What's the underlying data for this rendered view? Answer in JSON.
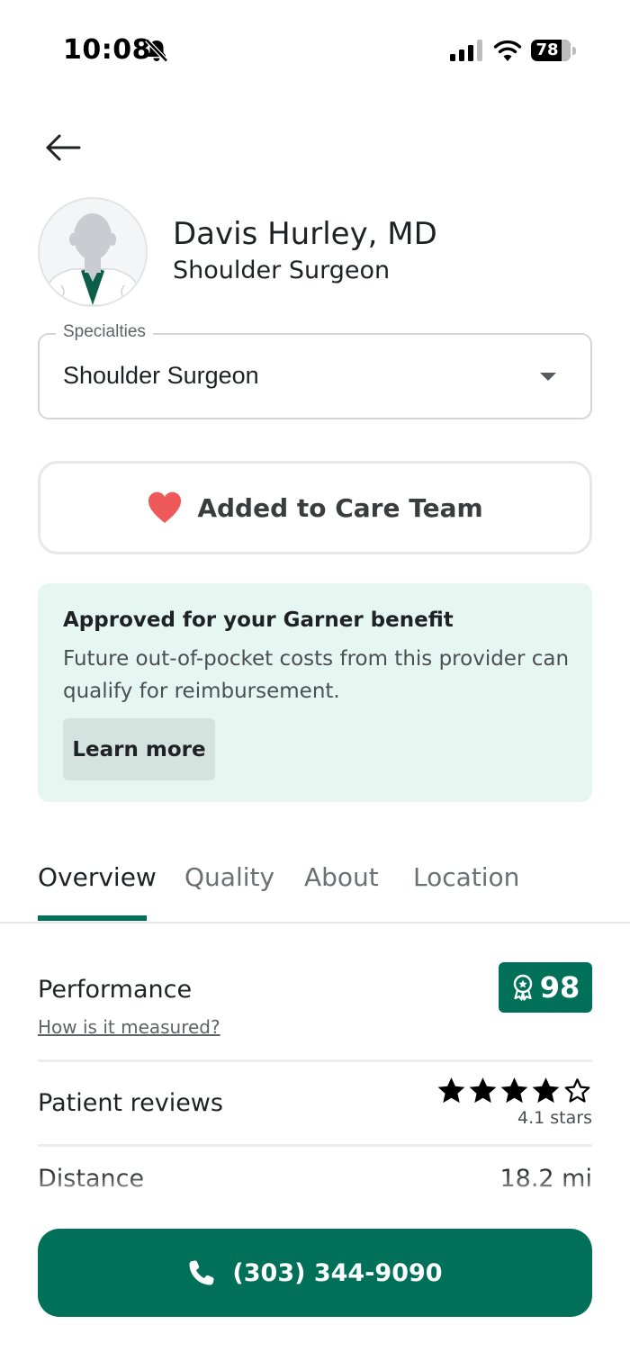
{
  "status_bar": {
    "time": "10:08",
    "battery": "78",
    "icons": [
      "bell-slash-icon",
      "cellular-signal-icon",
      "wifi-icon",
      "battery-icon"
    ]
  },
  "navigation": {
    "back_icon": "arrow-left-icon"
  },
  "provider": {
    "name": "Davis Hurley, MD",
    "specialty": "Shoulder Surgeon",
    "avatar_icon": "doctor-avatar-icon"
  },
  "specialties_field": {
    "label": "Specialties",
    "selected": "Shoulder Surgeon"
  },
  "care_team": {
    "label": "Added to Care Team",
    "icon": "heart-icon",
    "icon_color": "#ee5a5a"
  },
  "benefit": {
    "title": "Approved for your Garner benefit",
    "description": "Future out-of-pocket costs from this provider can qualify for reimbursement.",
    "button_label": "Learn more"
  },
  "tabs": [
    {
      "label": "Overview",
      "active": true
    },
    {
      "label": "Quality",
      "active": false
    },
    {
      "label": "About",
      "active": false
    },
    {
      "label": "Location",
      "active": false
    }
  ],
  "overview": {
    "performance": {
      "label": "Performance",
      "score": "98",
      "badge_icon": "award-ribbon-icon",
      "link": "How is it measured?"
    },
    "reviews": {
      "label": "Patient reviews",
      "rating": 4.1,
      "rating_text": "4.1 stars",
      "max_stars": 5
    },
    "distance": {
      "label": "Distance",
      "value": "18.2 mi"
    }
  },
  "call_button": {
    "label": "(303) 344-9090",
    "icon": "phone-icon"
  },
  "colors": {
    "brand_green": "#007059",
    "benefit_bg": "#e6f7f1",
    "learn_more_bg": "#d4e3dd",
    "heart": "#ee5a5a"
  }
}
